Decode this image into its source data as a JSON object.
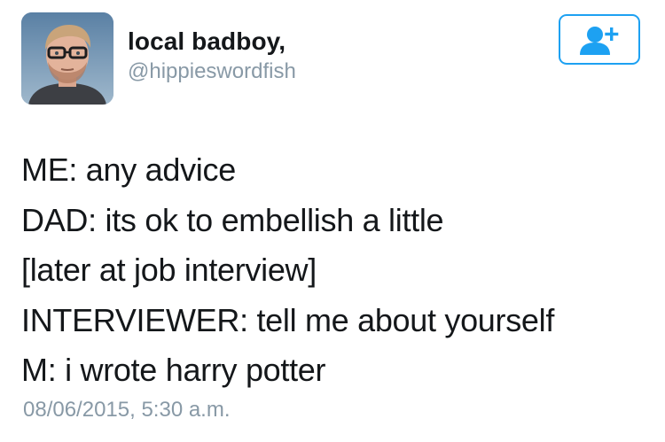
{
  "author": {
    "display_name": "local badboy,",
    "handle": "@hippieswordfish"
  },
  "follow_button": {
    "icon": "add-user-icon",
    "color": "#1da1f2"
  },
  "tweet": {
    "lines": [
      "ME: any advice",
      "DAD: its ok to embellish a little",
      "[later at job interview]",
      "INTERVIEWER: tell me about yourself",
      "M: i wrote harry potter"
    ],
    "timestamp": "08/06/2015, 5:30 a.m."
  },
  "colors": {
    "text": "#14171a",
    "secondary": "#8899a6",
    "accent": "#1da1f2"
  }
}
